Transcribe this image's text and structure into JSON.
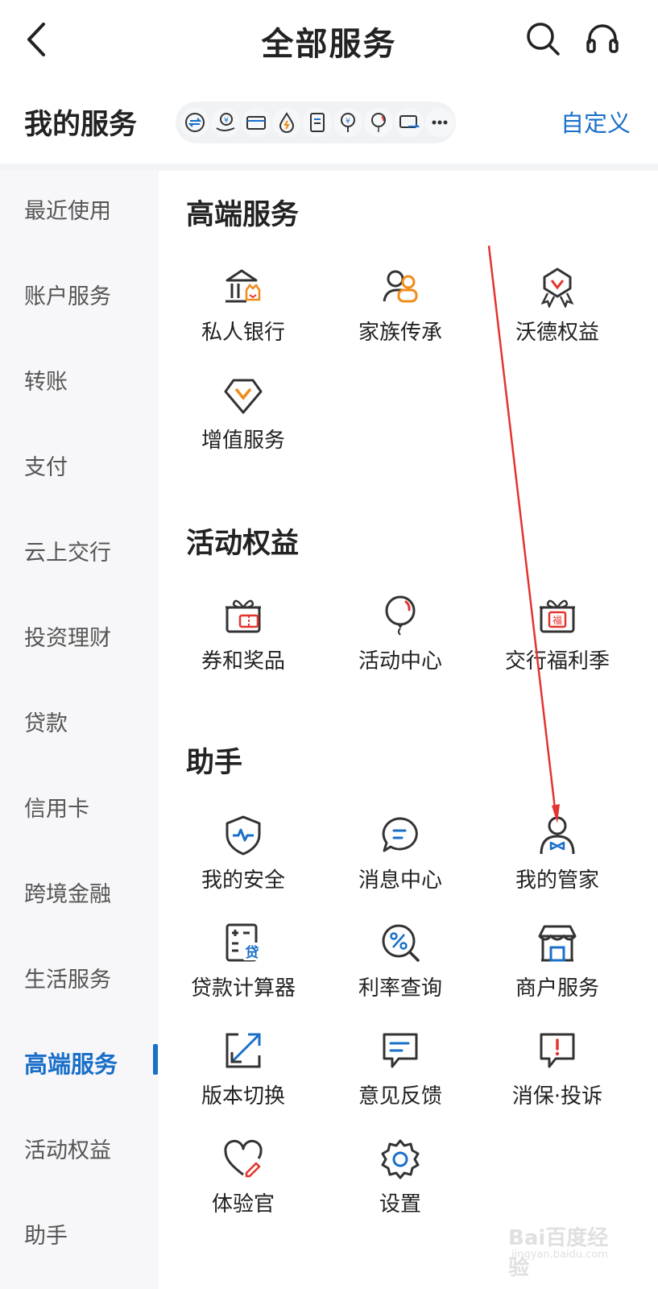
{
  "header": {
    "title": "全部服务"
  },
  "my_services": {
    "title": "我的服务",
    "customize_label": "自定义"
  },
  "sidebar": {
    "items": [
      {
        "label": "最近使用"
      },
      {
        "label": "账户服务"
      },
      {
        "label": "转账"
      },
      {
        "label": "支付"
      },
      {
        "label": "云上交行"
      },
      {
        "label": "投资理财"
      },
      {
        "label": "贷款"
      },
      {
        "label": "信用卡"
      },
      {
        "label": "跨境金融"
      },
      {
        "label": "生活服务"
      },
      {
        "label": "高端服务"
      },
      {
        "label": "活动权益"
      },
      {
        "label": "助手"
      }
    ],
    "active": "高端服务"
  },
  "sections": [
    {
      "title": "高端服务",
      "tiles": [
        {
          "label": "私人银行",
          "icon": "private-bank-icon"
        },
        {
          "label": "家族传承",
          "icon": "family-inheritance-icon"
        },
        {
          "label": "沃德权益",
          "icon": "wealth-rights-icon"
        },
        {
          "label": "增值服务",
          "icon": "diamond-icon"
        }
      ]
    },
    {
      "title": "活动权益",
      "tiles": [
        {
          "label": "券和奖品",
          "icon": "gift-coupon-icon"
        },
        {
          "label": "活动中心",
          "icon": "balloon-icon"
        },
        {
          "label": "交行福利季",
          "icon": "gift-fu-icon"
        }
      ]
    },
    {
      "title": "助手",
      "tiles": [
        {
          "label": "我的安全",
          "icon": "shield-icon"
        },
        {
          "label": "消息中心",
          "icon": "chat-icon"
        },
        {
          "label": "我的管家",
          "icon": "butler-icon"
        },
        {
          "label": "贷款计算器",
          "icon": "calculator-icon"
        },
        {
          "label": "利率查询",
          "icon": "percent-search-icon"
        },
        {
          "label": "商户服务",
          "icon": "store-icon"
        },
        {
          "label": "版本切换",
          "icon": "expand-icon"
        },
        {
          "label": "意见反馈",
          "icon": "feedback-icon"
        },
        {
          "label": "消保·投诉",
          "icon": "complaint-icon"
        },
        {
          "label": "体验官",
          "icon": "heart-edit-icon"
        },
        {
          "label": "设置",
          "icon": "gear-icon"
        }
      ]
    }
  ],
  "watermark": {
    "text": "Bai百度经验",
    "url": "jingyan.baidu.com"
  },
  "colors": {
    "accent": "#1a6fc9",
    "orange": "#f08c1a",
    "red": "#e3342f",
    "icon_dark": "#333333"
  }
}
